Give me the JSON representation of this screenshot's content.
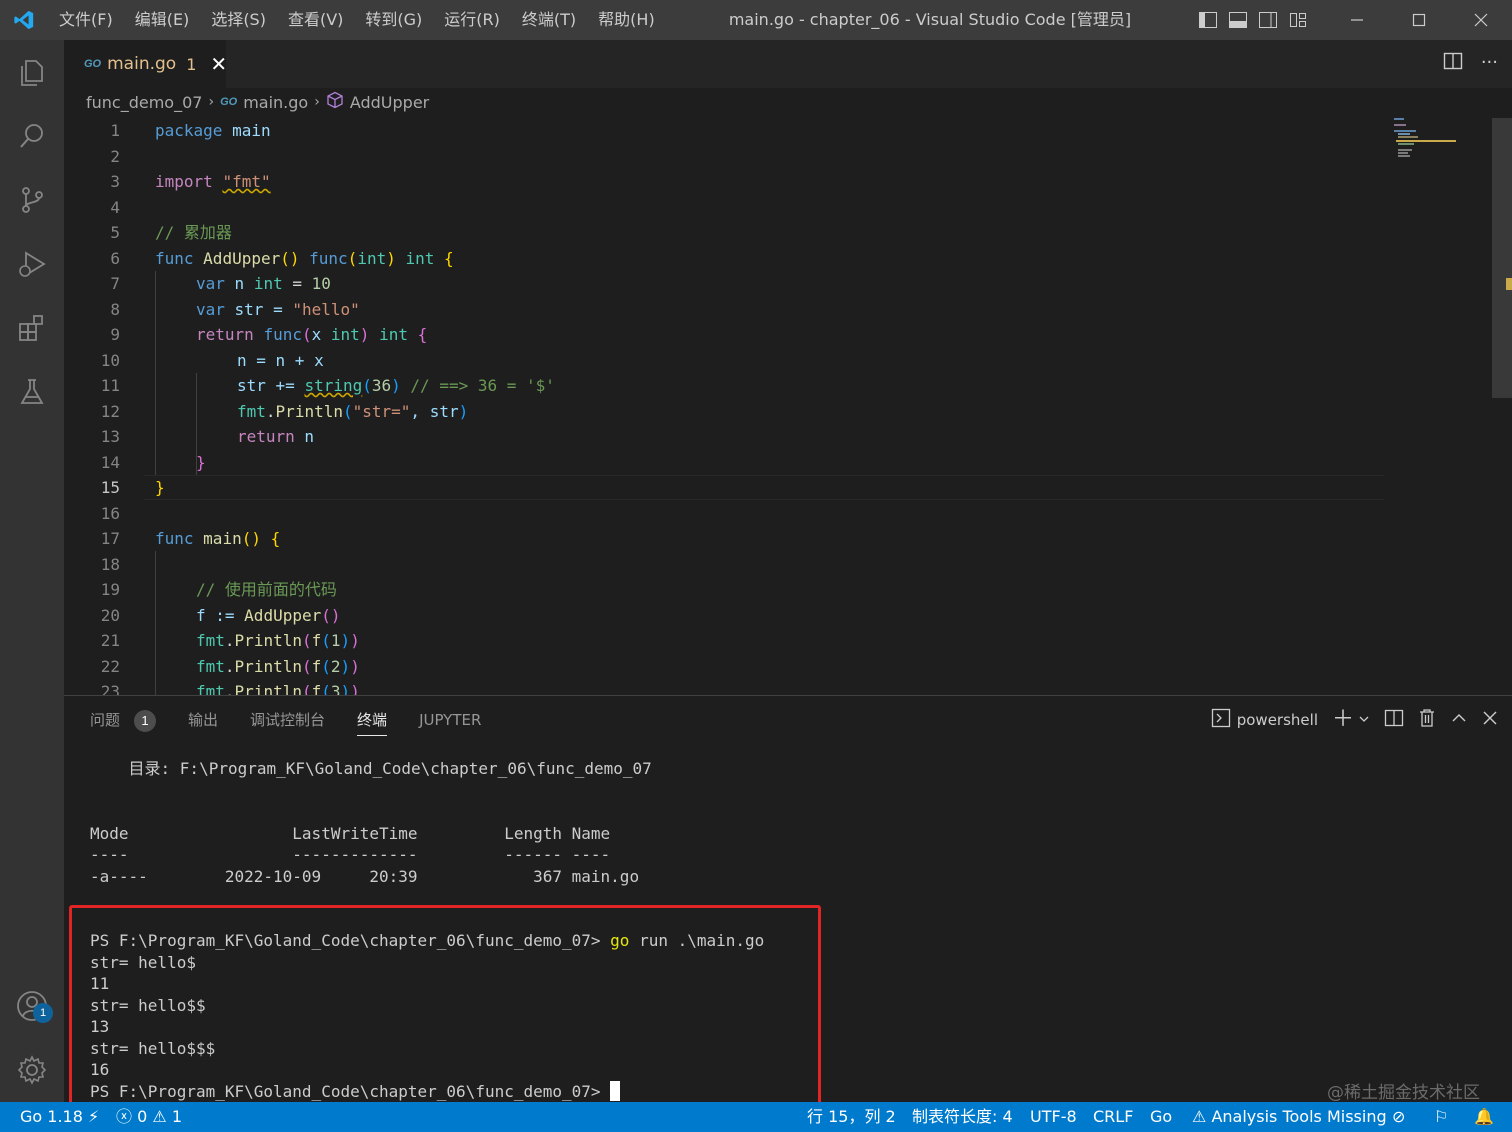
{
  "titlebar": {
    "menu": [
      "文件(F)",
      "编辑(E)",
      "选择(S)",
      "查看(V)",
      "转到(G)",
      "运行(R)",
      "终端(T)",
      "帮助(H)"
    ],
    "title": "main.go - chapter_06 - Visual Studio Code [管理员]"
  },
  "activity_bar": {
    "items": [
      "explorer-icon",
      "search-icon",
      "source-control-icon",
      "run-debug-icon",
      "extensions-icon",
      "testing-icon"
    ],
    "account_badge": "1"
  },
  "editor": {
    "tab": {
      "badge": "GO",
      "name": "main.go",
      "problems": "1"
    },
    "breadcrumb": [
      "func_demo_07",
      "main.go",
      "AddUpper"
    ],
    "active_line": 15,
    "lines": [
      {
        "n": "1"
      },
      {
        "n": "2"
      },
      {
        "n": "3"
      },
      {
        "n": "4"
      },
      {
        "n": "5"
      },
      {
        "n": "6"
      },
      {
        "n": "7"
      },
      {
        "n": "8"
      },
      {
        "n": "9"
      },
      {
        "n": "10"
      },
      {
        "n": "11"
      },
      {
        "n": "12"
      },
      {
        "n": "13"
      },
      {
        "n": "14"
      },
      {
        "n": "15"
      },
      {
        "n": "16"
      },
      {
        "n": "17"
      },
      {
        "n": "18"
      },
      {
        "n": "19"
      },
      {
        "n": "20"
      },
      {
        "n": "21"
      },
      {
        "n": "22"
      },
      {
        "n": "23"
      }
    ],
    "code": {
      "l1": [
        "package",
        " main"
      ],
      "l3": [
        "import",
        " ",
        "\"fmt\""
      ],
      "l5": "// 累加器",
      "l6": [
        "func",
        " ",
        "AddUpper",
        "()",
        " ",
        "func",
        "(",
        "int",
        ")",
        " ",
        "int",
        " {"
      ],
      "l7": [
        "var",
        " n ",
        "int",
        " = ",
        "10"
      ],
      "l8": [
        "var",
        " str = ",
        "\"hello\""
      ],
      "l9": [
        "return",
        " ",
        "func",
        "(",
        "x",
        " ",
        "int",
        ")",
        " ",
        "int",
        " {"
      ],
      "l10": "n = n + x",
      "l11": [
        "str += ",
        "string",
        "(",
        "36",
        ")",
        " // ==> 36 = '$'"
      ],
      "l12": [
        "fmt",
        ".",
        "Println",
        "(",
        "\"str=\"",
        ", str",
        ")"
      ],
      "l13": [
        "return",
        " n"
      ],
      "l14": "}",
      "l15": "}",
      "l17": [
        "func",
        " ",
        "main",
        "()",
        " {"
      ],
      "l19": "// 使用前面的代码",
      "l20": [
        "f := ",
        "AddUpper",
        "()"
      ],
      "l21": [
        "fmt",
        ".",
        "Println",
        "(",
        "f",
        "(",
        "1",
        ")",
        ")"
      ],
      "l22": [
        "fmt",
        ".",
        "Println",
        "(",
        "f",
        "(",
        "2",
        ")",
        ")"
      ],
      "l23": [
        "fmt",
        ".",
        "Println",
        "(",
        "f",
        "(",
        "3",
        ")",
        ")"
      ]
    }
  },
  "panel": {
    "tabs": [
      "问题",
      "输出",
      "调试控制台",
      "终端",
      "JUPYTER"
    ],
    "problems_count": "1",
    "active_tab": "终端",
    "shell": "powershell",
    "terminal_lines": [
      "    目录: F:\\Program_KF\\Goland_Code\\chapter_06\\func_demo_07",
      "",
      "",
      "Mode                 LastWriteTime         Length Name",
      "----                 -------------         ------ ----",
      "-a----        2022-10-09     20:39            367 main.go",
      "",
      "",
      "PS F:\\Program_KF\\Goland_Code\\chapter_06\\func_demo_07> ",
      "str= hello$",
      "11",
      "str= hello$$",
      "13",
      "str= hello$$$",
      "16",
      "PS F:\\Program_KF\\Goland_Code\\chapter_06\\func_demo_07> "
    ],
    "command": "go",
    "command_args": " run .\\main.go"
  },
  "watermark": "@稀土掘金技术社区",
  "statusbar": {
    "go_version": "Go 1.18",
    "errors": "0",
    "warnings": "1",
    "position": "行 15，列 2",
    "tab_size": "制表符长度: 4",
    "encoding": "UTF-8",
    "eol": "CRLF",
    "language": "Go",
    "analysis": "Analysis Tools Missing"
  },
  "colors": {
    "accent": "#007acc",
    "highlight_box": "#e12424"
  }
}
